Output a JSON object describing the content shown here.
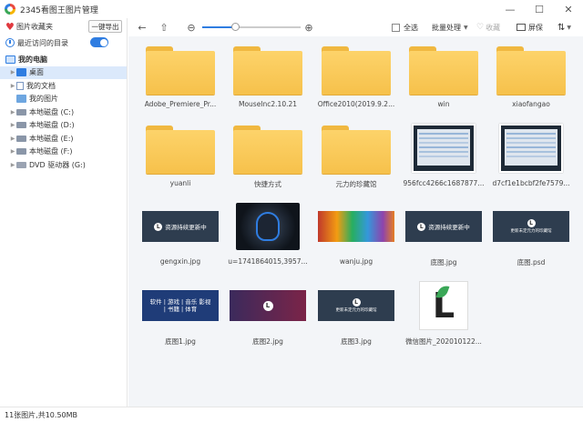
{
  "app": {
    "title": "2345看图王图片管理"
  },
  "window": {
    "minimize": "—",
    "maximize": "☐",
    "close": "✕"
  },
  "sidebar": {
    "favorites_label": "图片收藏夹",
    "export_button": "一键导出",
    "recent_label": "最近访问的目录",
    "recent_toggle_on": true,
    "tree": [
      {
        "label": "我的电脑",
        "icon": "computer-icon",
        "level": 0,
        "bold": true
      },
      {
        "label": "桌面",
        "icon": "desktop-icon",
        "level": 1,
        "selected": true
      },
      {
        "label": "我的文档",
        "icon": "document-icon",
        "level": 1
      },
      {
        "label": "我的图片",
        "icon": "picture-icon",
        "level": 1
      },
      {
        "label": "本地磁盘 (C:)",
        "icon": "disk-icon",
        "level": 1
      },
      {
        "label": "本地磁盘 (D:)",
        "icon": "disk-icon",
        "level": 1
      },
      {
        "label": "本地磁盘 (E:)",
        "icon": "disk-icon",
        "level": 1
      },
      {
        "label": "本地磁盘 (F:)",
        "icon": "disk-icon",
        "level": 1
      },
      {
        "label": "DVD 驱动器 (G:)",
        "icon": "dvd-icon",
        "level": 1
      }
    ]
  },
  "toolbar": {
    "select_all": "全选",
    "batch": "批量处理",
    "favorite": "收藏",
    "fullscreen": "屏保",
    "zoom_level": 0.33
  },
  "files": [
    {
      "name": "Adobe_Premiere_Pr...",
      "kind": "folder"
    },
    {
      "name": "MouseInc2.10.21",
      "kind": "folder"
    },
    {
      "name": "Office2010(2019.9.2...",
      "kind": "folder"
    },
    {
      "name": "win",
      "kind": "folder"
    },
    {
      "name": "xiaofangao",
      "kind": "folder"
    },
    {
      "name": "yuanli",
      "kind": "folder"
    },
    {
      "name": "快捷方式",
      "kind": "folder"
    },
    {
      "name": "元力的珍藏馆",
      "kind": "folder"
    },
    {
      "name": "956fcc4266c1687877...",
      "kind": "screenshot"
    },
    {
      "name": "d7cf1e1bcbf2fe7579...",
      "kind": "screenshot"
    },
    {
      "name": "gengxin.jpg",
      "kind": "banner",
      "text": "资源持续更新中"
    },
    {
      "name": "u=1741864015,3957...",
      "kind": "mouse"
    },
    {
      "name": "wanju.jpg",
      "kind": "toy"
    },
    {
      "name": "底图.jpg",
      "kind": "banner",
      "text": "资源持续更新中"
    },
    {
      "name": "底图.psd",
      "kind": "logo-banner",
      "text": "更新未定元力的珍藏馆"
    },
    {
      "name": "底图1.jpg",
      "kind": "soft",
      "text": "软件 | 游戏 | 音乐 影视 | 书籍 | 体育"
    },
    {
      "name": "底图2.jpg",
      "kind": "purple"
    },
    {
      "name": "底图3.jpg",
      "kind": "logo-banner",
      "text": "更新未定元力的珍藏馆"
    },
    {
      "name": "微信图片_202010122...",
      "kind": "wechat"
    }
  ],
  "status": {
    "text": "11张图片,共10.50MB"
  },
  "colors": {
    "accent": "#2f7de1",
    "folder": "#f6c14b",
    "grid_bg": "#f3f5f8"
  }
}
